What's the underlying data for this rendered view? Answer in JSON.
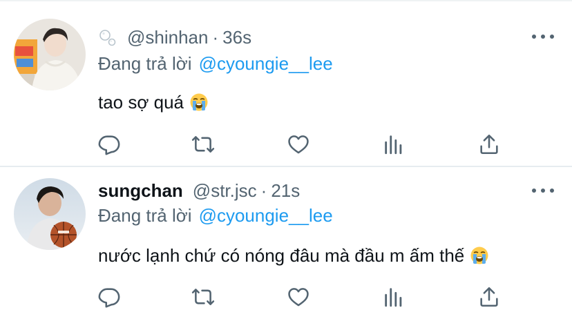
{
  "colors": {
    "text": "#0f1419",
    "secondary": "#536471",
    "link": "#1d9bf0",
    "divider": "#e6ecf0"
  },
  "tweets": [
    {
      "display_name": "",
      "name_emoji": "bubbles-icon",
      "handle": "@shinhan",
      "dot": "·",
      "time": "36s",
      "reply_prefix": "Đang trả lời",
      "reply_to": "@cyoungie__lee",
      "text": "tao sợ quá",
      "text_emoji": "loudly-crying-face-icon"
    },
    {
      "display_name": "sungchan",
      "handle": "@str.jsc",
      "dot": "·",
      "time": "21s",
      "reply_prefix": "Đang trả lời",
      "reply_to": "@cyoungie__lee",
      "text": "nước lạnh chứ có nóng đâu mà đầu m ấm thế",
      "text_emoji": "loudly-crying-face-icon"
    }
  ],
  "action_icons": [
    "reply-icon",
    "retweet-icon",
    "like-icon",
    "views-icon",
    "share-icon"
  ]
}
